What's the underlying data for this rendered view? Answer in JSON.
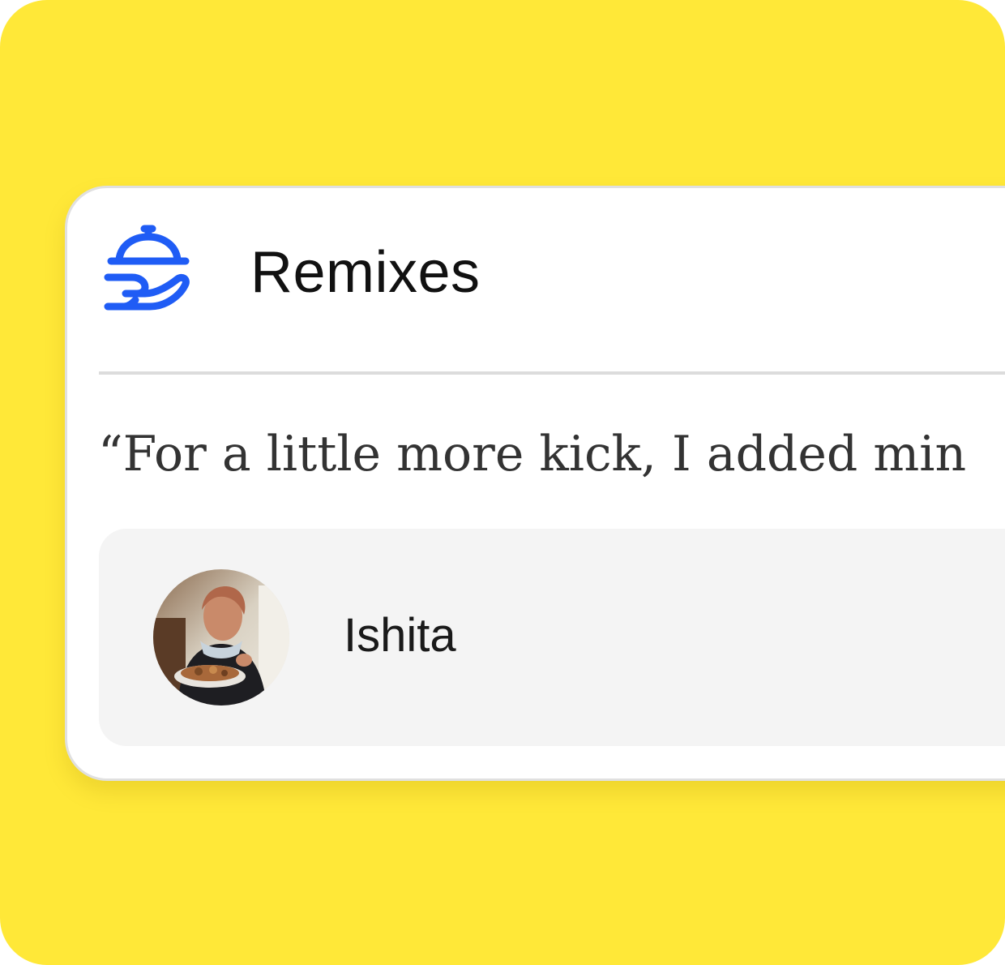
{
  "colors": {
    "background": "#FFE838",
    "card": "#FFFFFF",
    "accent_icon": "#1F5CF5",
    "author_box": "#F4F4F4"
  },
  "header": {
    "icon": "serving-cloche-hand-icon",
    "title": "Remixes"
  },
  "remix": {
    "quote": "“For a little more kick, I added min",
    "author": {
      "avatar": "avatar-photo",
      "name": "Ishita"
    }
  }
}
